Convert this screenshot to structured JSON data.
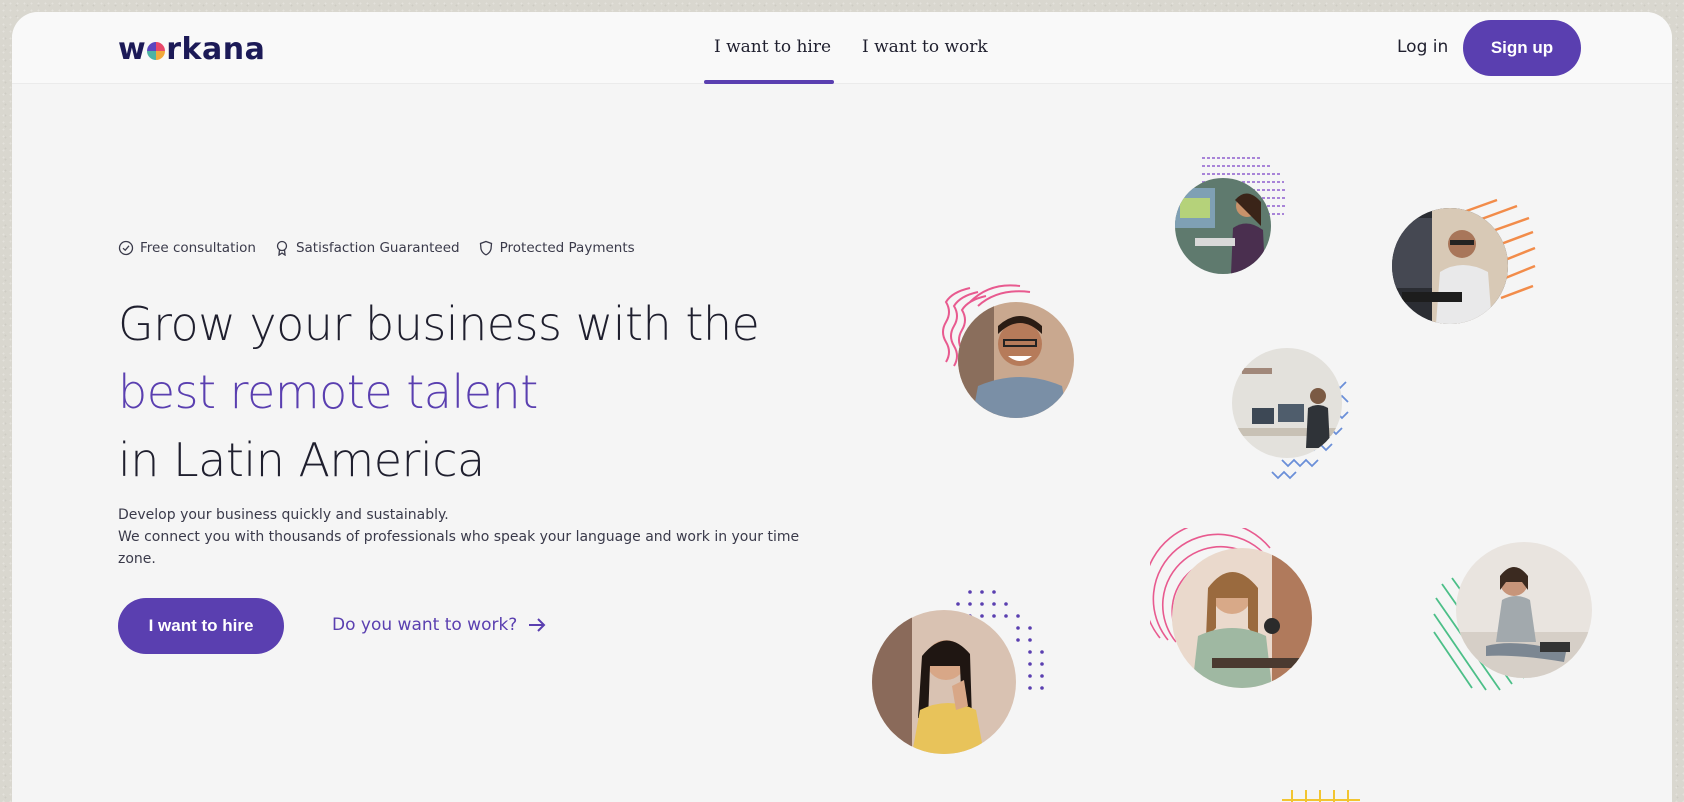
{
  "brand": {
    "name_before": "w",
    "name_after": "rkana"
  },
  "nav": {
    "tabs": [
      {
        "label": "I want to hire",
        "active": true
      },
      {
        "label": "I want to work",
        "active": false
      }
    ],
    "login_label": "Log in",
    "signup_label": "Sign up"
  },
  "badges": [
    {
      "icon": "check-circle-icon",
      "label": "Free consultation"
    },
    {
      "icon": "award-icon",
      "label": "Satisfaction Guaranteed"
    },
    {
      "icon": "shield-icon",
      "label": "Protected Payments"
    }
  ],
  "hero": {
    "line1": "Grow your business with the",
    "line2": "best remote talent",
    "line3": "in Latin America",
    "desc1": "Develop your business quickly and sustainably.",
    "desc2": "We connect you with thousands of professionals who speak your language and work in your time zone."
  },
  "cta": {
    "primary_label": "I want to hire",
    "secondary_label": "Do you want to work?"
  },
  "colors": {
    "accent": "#5a3fb0",
    "brand_dark": "#1c1a57",
    "pink": "#e85a8f",
    "orange": "#f28c4a",
    "blue": "#6a8fd8",
    "green": "#4cbf88",
    "yellow": "#f2c530"
  }
}
